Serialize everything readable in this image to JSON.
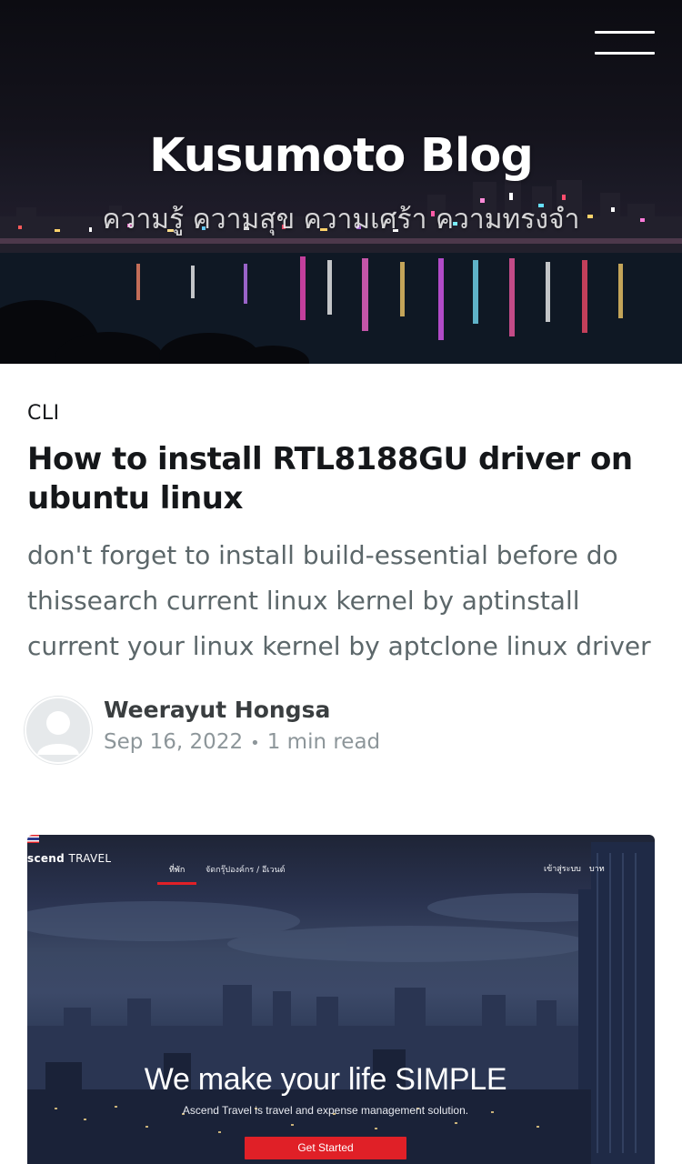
{
  "site": {
    "title": "Kusumoto Blog",
    "description": "ความรู้ ความสุข ความเศร้า ความทรงจำ"
  },
  "nav": {
    "menu_icon": "hamburger-menu-icon"
  },
  "post": {
    "tag": "CLI",
    "title": "How to install RTL8188GU driver on ubuntu linux",
    "excerpt": "don't forget to install build-essential before do thissearch current linux kernel by aptinstall current your linux kernel by aptclone linux driver",
    "author": "Weerayut Hongsa",
    "date": "Sep 16, 2022",
    "separator": "•",
    "reading_time": "1 min read"
  },
  "next_post_image": {
    "logo_bold": "scend",
    "logo_light": "TRAVEL",
    "nav_items": [
      "ที่พัก",
      "จัดกรุ๊ปองค์กร / อีเวนต์"
    ],
    "login": "เข้าสู่ระบบ",
    "currency": "บาท",
    "headline": "We make your life SIMPLE",
    "subheadline": "Ascend Travel is travel and expense management solution.",
    "cta": "Get Started",
    "accent_color": "#e02027"
  }
}
